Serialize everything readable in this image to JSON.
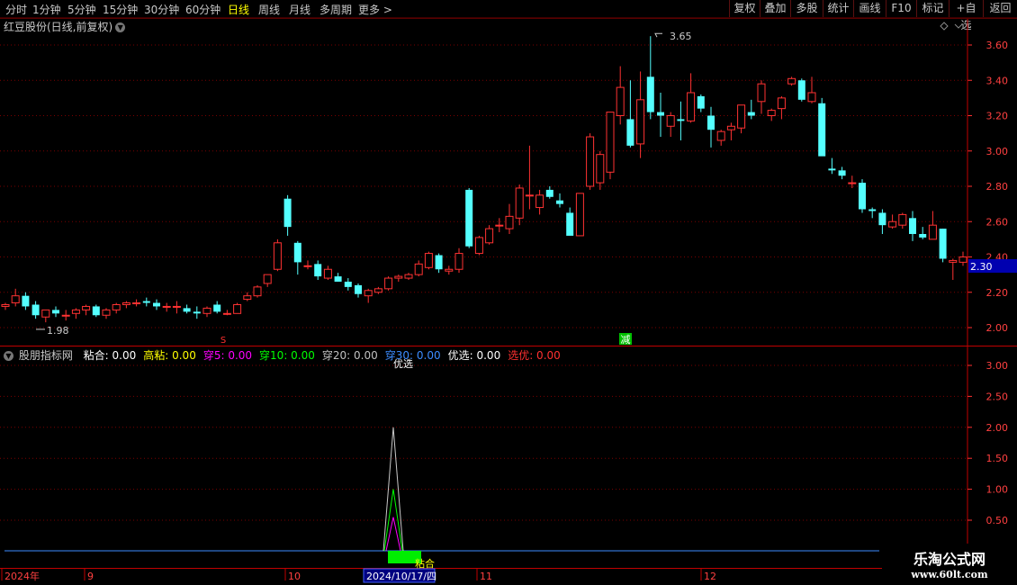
{
  "toolbar": {
    "timeframes": [
      "分时",
      "1分钟",
      "5分钟",
      "15分钟",
      "30分钟",
      "60分钟",
      "日线",
      "周线",
      "月线",
      "多周期",
      "更多 >"
    ],
    "active_timeframe": "日线",
    "buttons": [
      "复权",
      "叠加",
      "多股",
      "统计",
      "画线",
      "F10",
      "标记",
      "+自选",
      "返回"
    ]
  },
  "main_chart": {
    "title": "红豆股份(日线,前复权)",
    "price_labels": [
      "3.60",
      "3.40",
      "3.20",
      "3.00",
      "2.80",
      "2.60",
      "2.40",
      "2.20",
      "2.00"
    ],
    "current_price": "2.30",
    "high_label": "3.65",
    "low_label": "1.98",
    "marker_s": "S",
    "marker_reduce": "减",
    "colors": {
      "up": "#ff3232",
      "down": "#54ffff",
      "grid": "#7a0000",
      "axis_text": "#ff4040"
    }
  },
  "indicator": {
    "name": "股朋指标网",
    "fields": [
      {
        "label": "粘合:",
        "value": "0.00",
        "color": "#ffffff"
      },
      {
        "label": "高粘:",
        "value": "0.00",
        "color": "#ffff00"
      },
      {
        "label": "穿5:",
        "value": "0.00",
        "color": "#ff00ff"
      },
      {
        "label": "穿10:",
        "value": "0.00",
        "color": "#00ff00"
      },
      {
        "label": "穿20:",
        "value": "0.00",
        "color": "#c0c0c0"
      },
      {
        "label": "穿30:",
        "value": "0.00",
        "color": "#3c8cff"
      },
      {
        "label": "优选:",
        "value": "0.00",
        "color": "#ffffff"
      },
      {
        "label": "选优:",
        "value": "0.00",
        "color": "#ff3030"
      }
    ],
    "scale_labels": [
      "3.00",
      "2.50",
      "2.00",
      "1.50",
      "1.00",
      "0.50"
    ],
    "annotation_top": "优选",
    "annotation_bottom": "粘合"
  },
  "time_axis": {
    "labels": [
      "2024年",
      "9",
      "10",
      "2024/10/17/四",
      "11",
      "12"
    ]
  },
  "watermark": {
    "line1": "乐淘公式网",
    "line2": "www.60lt.com"
  }
}
